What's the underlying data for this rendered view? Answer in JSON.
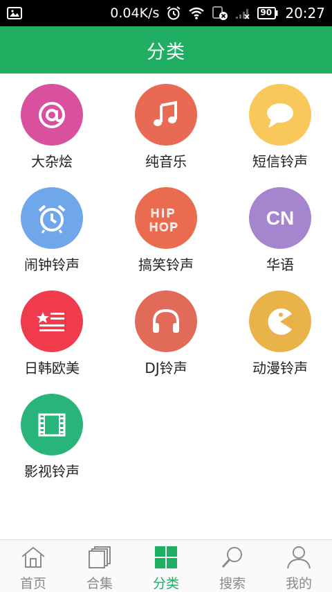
{
  "status_bar": {
    "speed": "0.04K/s",
    "battery": "90",
    "time": "20:27"
  },
  "header": {
    "title": "分类"
  },
  "categories": [
    {
      "label": "大杂烩",
      "icon": "at-sign-icon",
      "glyph": "@",
      "color": "#d9509f"
    },
    {
      "label": "纯音乐",
      "icon": "music-note-icon",
      "glyph": "♫",
      "color": "#e86a55"
    },
    {
      "label": "短信铃声",
      "icon": "chat-bubble-icon",
      "glyph": "",
      "color": "#f8c95a"
    },
    {
      "label": "闹钟铃声",
      "icon": "alarm-clock-icon",
      "glyph": "",
      "color": "#6fa7ea"
    },
    {
      "label": "搞笑铃声",
      "icon": "hip-hop-icon",
      "glyph": "HIP HOP",
      "color": "#ea6c50"
    },
    {
      "label": "华语",
      "icon": "cn-icon",
      "glyph": "CN",
      "color": "#a586ce"
    },
    {
      "label": "日韩欧美",
      "icon": "flag-icon",
      "glyph": "",
      "color": "#ef3b4b"
    },
    {
      "label": "DJ铃声",
      "icon": "headphones-icon",
      "glyph": "",
      "color": "#e26a58"
    },
    {
      "label": "动漫铃声",
      "icon": "pacman-icon",
      "glyph": "",
      "color": "#e9b34a"
    },
    {
      "label": "影视铃声",
      "icon": "film-icon",
      "glyph": "",
      "color": "#28b47a"
    }
  ],
  "tabs": [
    {
      "label": "首页",
      "icon": "home-icon",
      "active": false
    },
    {
      "label": "合集",
      "icon": "collection-icon",
      "active": false
    },
    {
      "label": "分类",
      "icon": "grid-icon",
      "active": true
    },
    {
      "label": "搜索",
      "icon": "search-icon",
      "active": false
    },
    {
      "label": "我的",
      "icon": "user-icon",
      "active": false
    }
  ],
  "colors": {
    "accent": "#1fae62",
    "inactive_tab": "#8a8a8a"
  }
}
